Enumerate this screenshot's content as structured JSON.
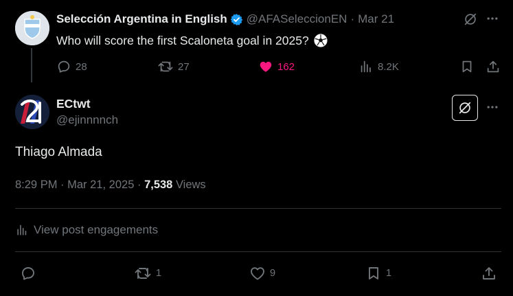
{
  "parent_tweet": {
    "author_name": "Selección Argentina in English",
    "handle": "@AFASeleccionEN",
    "separator": "·",
    "date": "Mar 21",
    "text": "Who will score the first Scaloneta goal in 2025?",
    "emoji_icon": "soccer-ball-icon",
    "metrics": {
      "replies": "28",
      "reposts": "27",
      "likes": "162",
      "views": "8.2K"
    },
    "liked": true
  },
  "reply_tweet": {
    "author_name": "ECtwt",
    "handle": "@ejinnnnch",
    "text": "Thiago Almada",
    "time": "8:29 PM",
    "date": "Mar 21, 2025",
    "separator": "·",
    "views_count": "7,538",
    "views_label": "Views",
    "engagements_label": "View post engagements",
    "metrics": {
      "reposts": "1",
      "likes": "9",
      "bookmarks": "1"
    }
  },
  "colors": {
    "background": "#000000",
    "text_primary": "#e7e9ea",
    "text_muted": "#71767b",
    "like_pink": "#f91880",
    "verified_blue": "#1d9bf0",
    "divider": "#2f3336"
  }
}
